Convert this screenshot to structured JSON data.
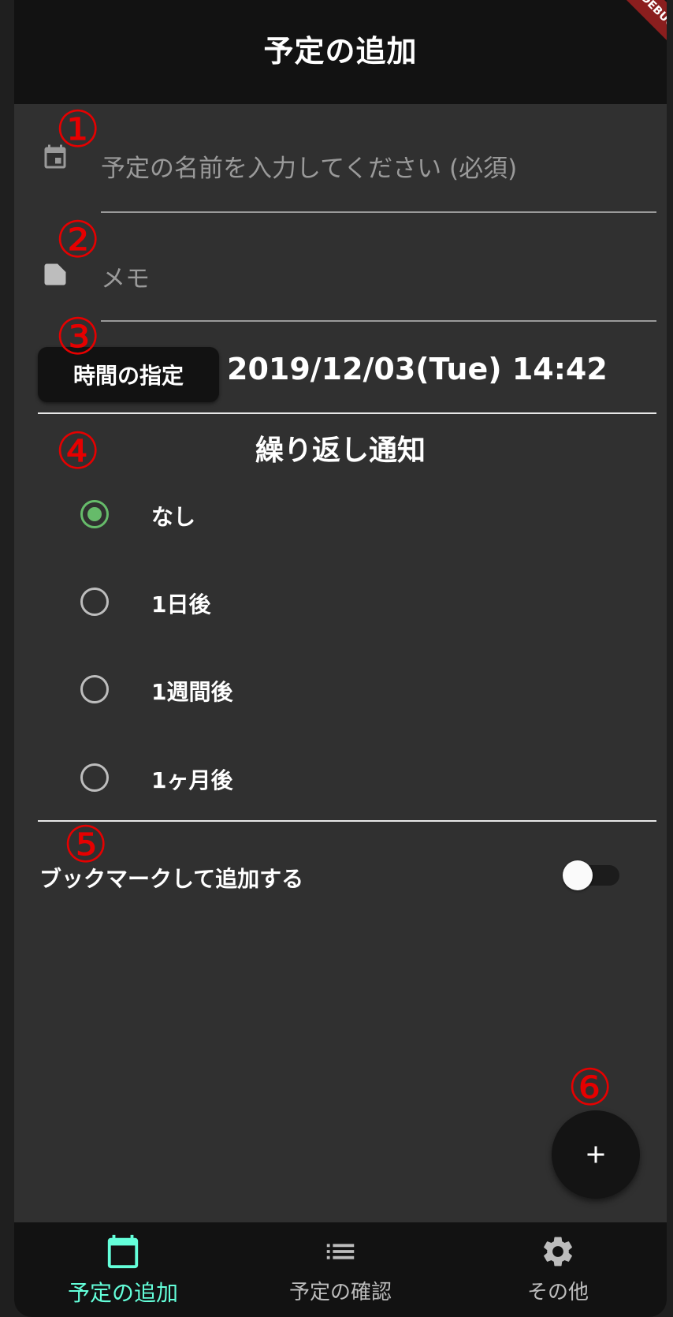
{
  "appbar": {
    "title": "予定の追加",
    "debug_banner": "DEBUG"
  },
  "fields": {
    "name_placeholder": "予定の名前を入力してください (必須)",
    "memo_placeholder": "メモ"
  },
  "time": {
    "button_label": "時間の指定",
    "datetime": "2019/12/03(Tue) 14:42"
  },
  "repeat": {
    "title": "繰り返し通知",
    "options": [
      "なし",
      "1日後",
      "1週間後",
      "1ヶ月後"
    ],
    "selected": "なし"
  },
  "bookmark": {
    "label": "ブックマークして追加する",
    "enabled": false
  },
  "annotations": [
    "①",
    "②",
    "③",
    "④",
    "⑤",
    "⑥"
  ],
  "bottom_nav": {
    "items": [
      {
        "label": "予定の追加",
        "icon": "calendar-icon",
        "active": true
      },
      {
        "label": "予定の確認",
        "icon": "list-icon",
        "active": false
      },
      {
        "label": "その他",
        "icon": "gear-icon",
        "active": false
      }
    ]
  },
  "colors": {
    "accent": "#64ffda",
    "radio_selected": "#66bb6a",
    "annotation": "#e60000",
    "background": "#303030",
    "bar": "#121212"
  }
}
